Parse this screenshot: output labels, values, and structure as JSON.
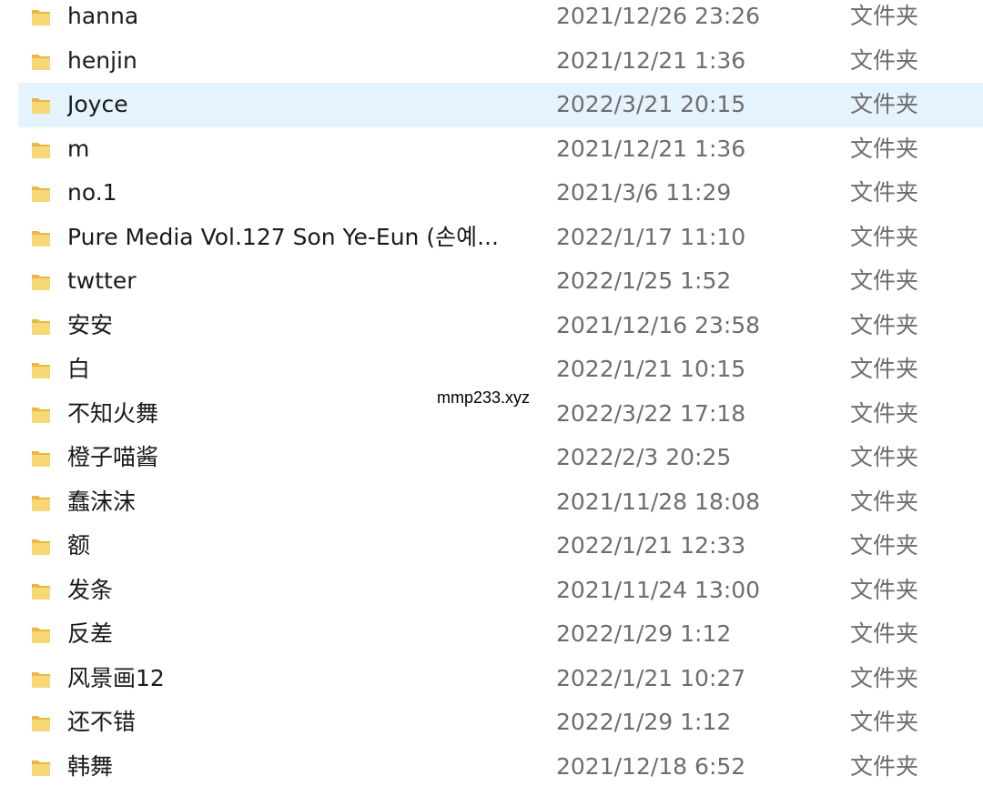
{
  "colors": {
    "selection_bg": "#e5f3ff",
    "name_text": "#1a1a1a",
    "meta_text": "#6d6d6d",
    "folder_body": "#f8d775",
    "folder_shade": "#e7b845"
  },
  "icons": {
    "folder": "folder-icon"
  },
  "files": [
    {
      "name": "hanna",
      "date": "2021/12/26 23:26",
      "type": "文件夹"
    },
    {
      "name": "henjin",
      "date": "2021/12/21 1:36",
      "type": "文件夹"
    },
    {
      "name": "Joyce",
      "date": "2022/3/21 20:15",
      "type": "文件夹",
      "selected": true
    },
    {
      "name": "m",
      "date": "2021/12/21 1:36",
      "type": "文件夹"
    },
    {
      "name": "no.1",
      "date": "2021/3/6 11:29",
      "type": "文件夹"
    },
    {
      "name": "Pure Media Vol.127 Son Ye-Eun (손예...",
      "date": "2022/1/17 11:10",
      "type": "文件夹"
    },
    {
      "name": "twtter",
      "date": "2022/1/25 1:52",
      "type": "文件夹"
    },
    {
      "name": "安安",
      "date": "2021/12/16 23:58",
      "type": "文件夹"
    },
    {
      "name": "白",
      "date": "2022/1/21 10:15",
      "type": "文件夹"
    },
    {
      "name": "不知火舞",
      "date": "2022/3/22 17:18",
      "type": "文件夹"
    },
    {
      "name": "橙子喵酱",
      "date": "2022/2/3 20:25",
      "type": "文件夹"
    },
    {
      "name": "蠢沫沫",
      "date": "2021/11/28 18:08",
      "type": "文件夹"
    },
    {
      "name": "额",
      "date": "2022/1/21 12:33",
      "type": "文件夹"
    },
    {
      "name": "发条",
      "date": "2021/11/24 13:00",
      "type": "文件夹"
    },
    {
      "name": "反差",
      "date": "2022/1/29 1:12",
      "type": "文件夹"
    },
    {
      "name": "风景画12",
      "date": "2022/1/21 10:27",
      "type": "文件夹"
    },
    {
      "name": "还不错",
      "date": "2022/1/29 1:12",
      "type": "文件夹"
    },
    {
      "name": "韩舞",
      "date": "2021/12/18 6:52",
      "type": "文件夹"
    }
  ],
  "watermark": "mmp233.xyz"
}
